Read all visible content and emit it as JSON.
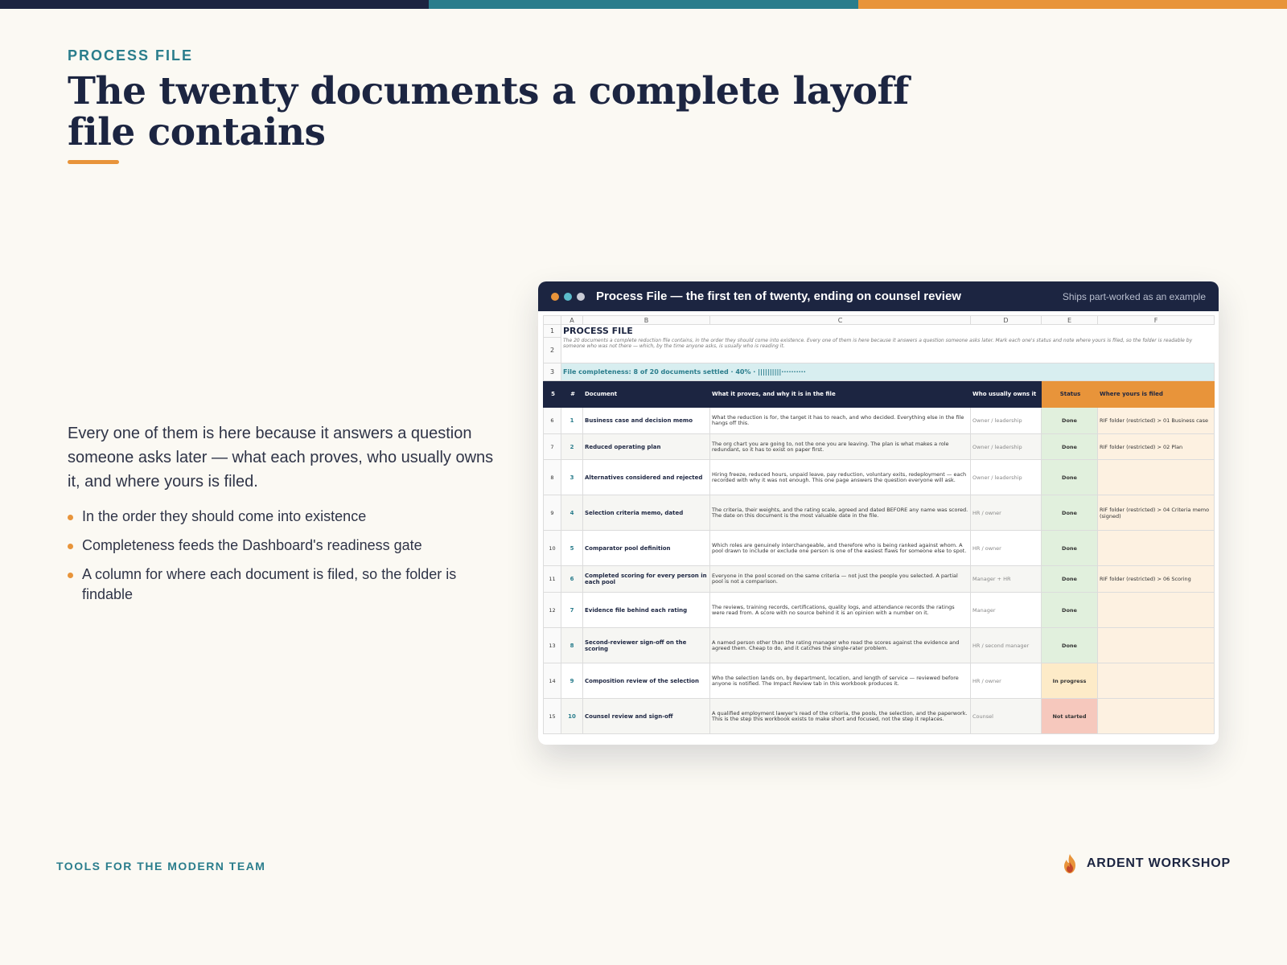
{
  "colors": {
    "navy": "#1c2541",
    "teal": "#2a7d8c",
    "orange": "#e8943a",
    "background": "#fbf9f3"
  },
  "topbar": [
    "#1c2541",
    "#2a7d8c",
    "#e8943a"
  ],
  "kicker": "PROCESS FILE",
  "title": "The twenty documents a complete layoff file contains",
  "intro": "Every one of them is here because it answers a question someone asks later — what each proves, who usually owns it, and where yours is filed.",
  "bullets": [
    "In the order they should come into existence",
    "Completeness feeds the Dashboard's readiness gate",
    "A column for where each document is filed, so the folder is findable"
  ],
  "window": {
    "title": "Process File — the first ten of twenty, ending on counsel review",
    "subtitle": "Ships part-worked as an example",
    "dot_colors": [
      "#e8943a",
      "#5bbccb",
      "#c9ccd6"
    ]
  },
  "sheet": {
    "columns": [
      "A",
      "B",
      "C",
      "D",
      "E",
      "F"
    ],
    "row_numbers": [
      "1",
      "2",
      "3",
      "5",
      "6",
      "7",
      "8",
      "9",
      "10",
      "11",
      "12",
      "13",
      "14",
      "15"
    ],
    "heading": "PROCESS FILE",
    "description": "The 20 documents a complete reduction file contains, in the order they should come into existence. Every one of them is here because it answers a question someone asks later. Mark each one's status and note where yours is filed, so the folder is readable by someone who was not there — which, by the time anyone asks, is usually who is reading it.",
    "completeness": "File completeness:  8 of 20 documents settled  ·  40%  ·  ||||||||||··········",
    "headers": {
      "num": "#",
      "document": "Document",
      "proves": "What it proves, and why it is in the file",
      "owner": "Who usually owns it",
      "status": "Status",
      "filed": "Where yours is filed"
    },
    "rows": [
      {
        "num": "1",
        "document": "Business case and decision memo",
        "proves": "What the reduction is for, the target it has to reach, and who decided. Everything else in the file hangs off this.",
        "owner": "Owner / leadership",
        "status": "Done",
        "status_kind": "done",
        "filed": "RIF folder (restricted) > 01 Business case"
      },
      {
        "num": "2",
        "document": "Reduced operating plan",
        "proves": "The org chart you are going to, not the one you are leaving. The plan is what makes a role redundant, so it has to exist on paper first.",
        "owner": "Owner / leadership",
        "status": "Done",
        "status_kind": "done",
        "filed": "RIF folder (restricted) > 02 Plan"
      },
      {
        "num": "3",
        "document": "Alternatives considered and rejected",
        "proves": "Hiring freeze, reduced hours, unpaid leave, pay reduction, voluntary exits, redeployment — each recorded with why it was not enough. This one page answers the question everyone will ask.",
        "owner": "Owner / leadership",
        "status": "Done",
        "status_kind": "done",
        "filed": ""
      },
      {
        "num": "4",
        "document": "Selection criteria memo, dated",
        "proves": "The criteria, their weights, and the rating scale, agreed and dated BEFORE any name was scored. The date on this document is the most valuable date in the file.",
        "owner": "HR / owner",
        "status": "Done",
        "status_kind": "done",
        "filed": "RIF folder (restricted) > 04 Criteria memo (signed)"
      },
      {
        "num": "5",
        "document": "Comparator pool definition",
        "proves": "Which roles are genuinely interchangeable, and therefore who is being ranked against whom. A pool drawn to include or exclude one person is one of the easiest flaws for someone else to spot.",
        "owner": "HR / owner",
        "status": "Done",
        "status_kind": "done",
        "filed": ""
      },
      {
        "num": "6",
        "document": "Completed scoring for every person in each pool",
        "proves": "Everyone in the pool scored on the same criteria — not just the people you selected. A partial pool is not a comparison.",
        "owner": "Manager + HR",
        "status": "Done",
        "status_kind": "done",
        "filed": "RIF folder (restricted) > 06 Scoring"
      },
      {
        "num": "7",
        "document": "Evidence file behind each rating",
        "proves": "The reviews, training records, certifications, quality logs, and attendance records the ratings were read from. A score with no source behind it is an opinion with a number on it.",
        "owner": "Manager",
        "status": "Done",
        "status_kind": "done",
        "filed": ""
      },
      {
        "num": "8",
        "document": "Second-reviewer sign-off on the scoring",
        "proves": "A named person other than the rating manager who read the scores against the evidence and agreed them. Cheap to do, and it catches the single-rater problem.",
        "owner": "HR / second manager",
        "status": "Done",
        "status_kind": "done",
        "filed": ""
      },
      {
        "num": "9",
        "document": "Composition review of the selection",
        "proves": "Who the selection lands on, by department, location, and length of service — reviewed before anyone is notified. The Impact Review tab in this workbook produces it.",
        "owner": "HR / owner",
        "status": "In progress",
        "status_kind": "prog",
        "filed": ""
      },
      {
        "num": "10",
        "document": "Counsel review and sign-off",
        "proves": "A qualified employment lawyer's read of the criteria, the pools, the selection, and the paperwork. This is the step this workbook exists to make short and focused, not the step it replaces.",
        "owner": "Counsel",
        "status": "Not started",
        "status_kind": "not",
        "filed": ""
      }
    ]
  },
  "footer": {
    "left": "TOOLS FOR THE MODERN TEAM",
    "brand": "ARDENT WORKSHOP",
    "logo_icon": "flame-icon"
  }
}
